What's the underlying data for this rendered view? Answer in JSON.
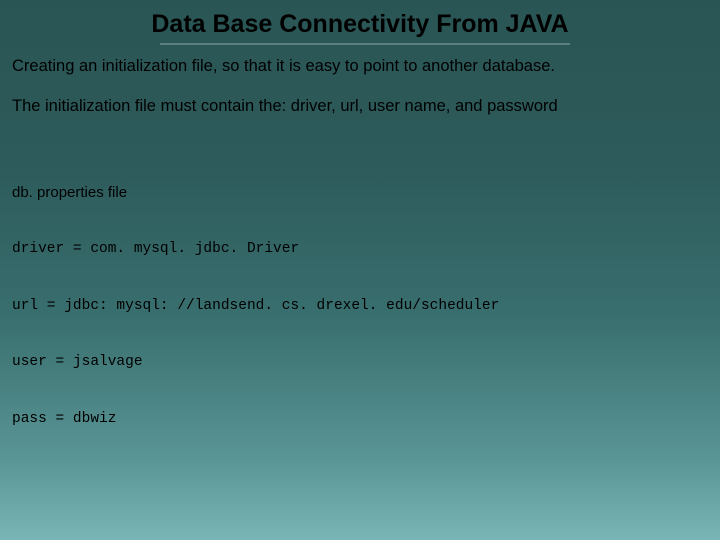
{
  "slide": {
    "title": "Data Base Connectivity From JAVA",
    "para1": "Creating an initialization file, so that it is easy to point to another database.",
    "para2": "The initialization file must contain the: driver, url, user name, and password",
    "code_label": "db. properties file",
    "code_lines": {
      "l1": "driver = com. mysql. jdbc. Driver",
      "l2": "url = jdbc: mysql: //landsend. cs. drexel. edu/scheduler",
      "l3": "user = jsalvage",
      "l4": "pass = dbwiz"
    }
  }
}
